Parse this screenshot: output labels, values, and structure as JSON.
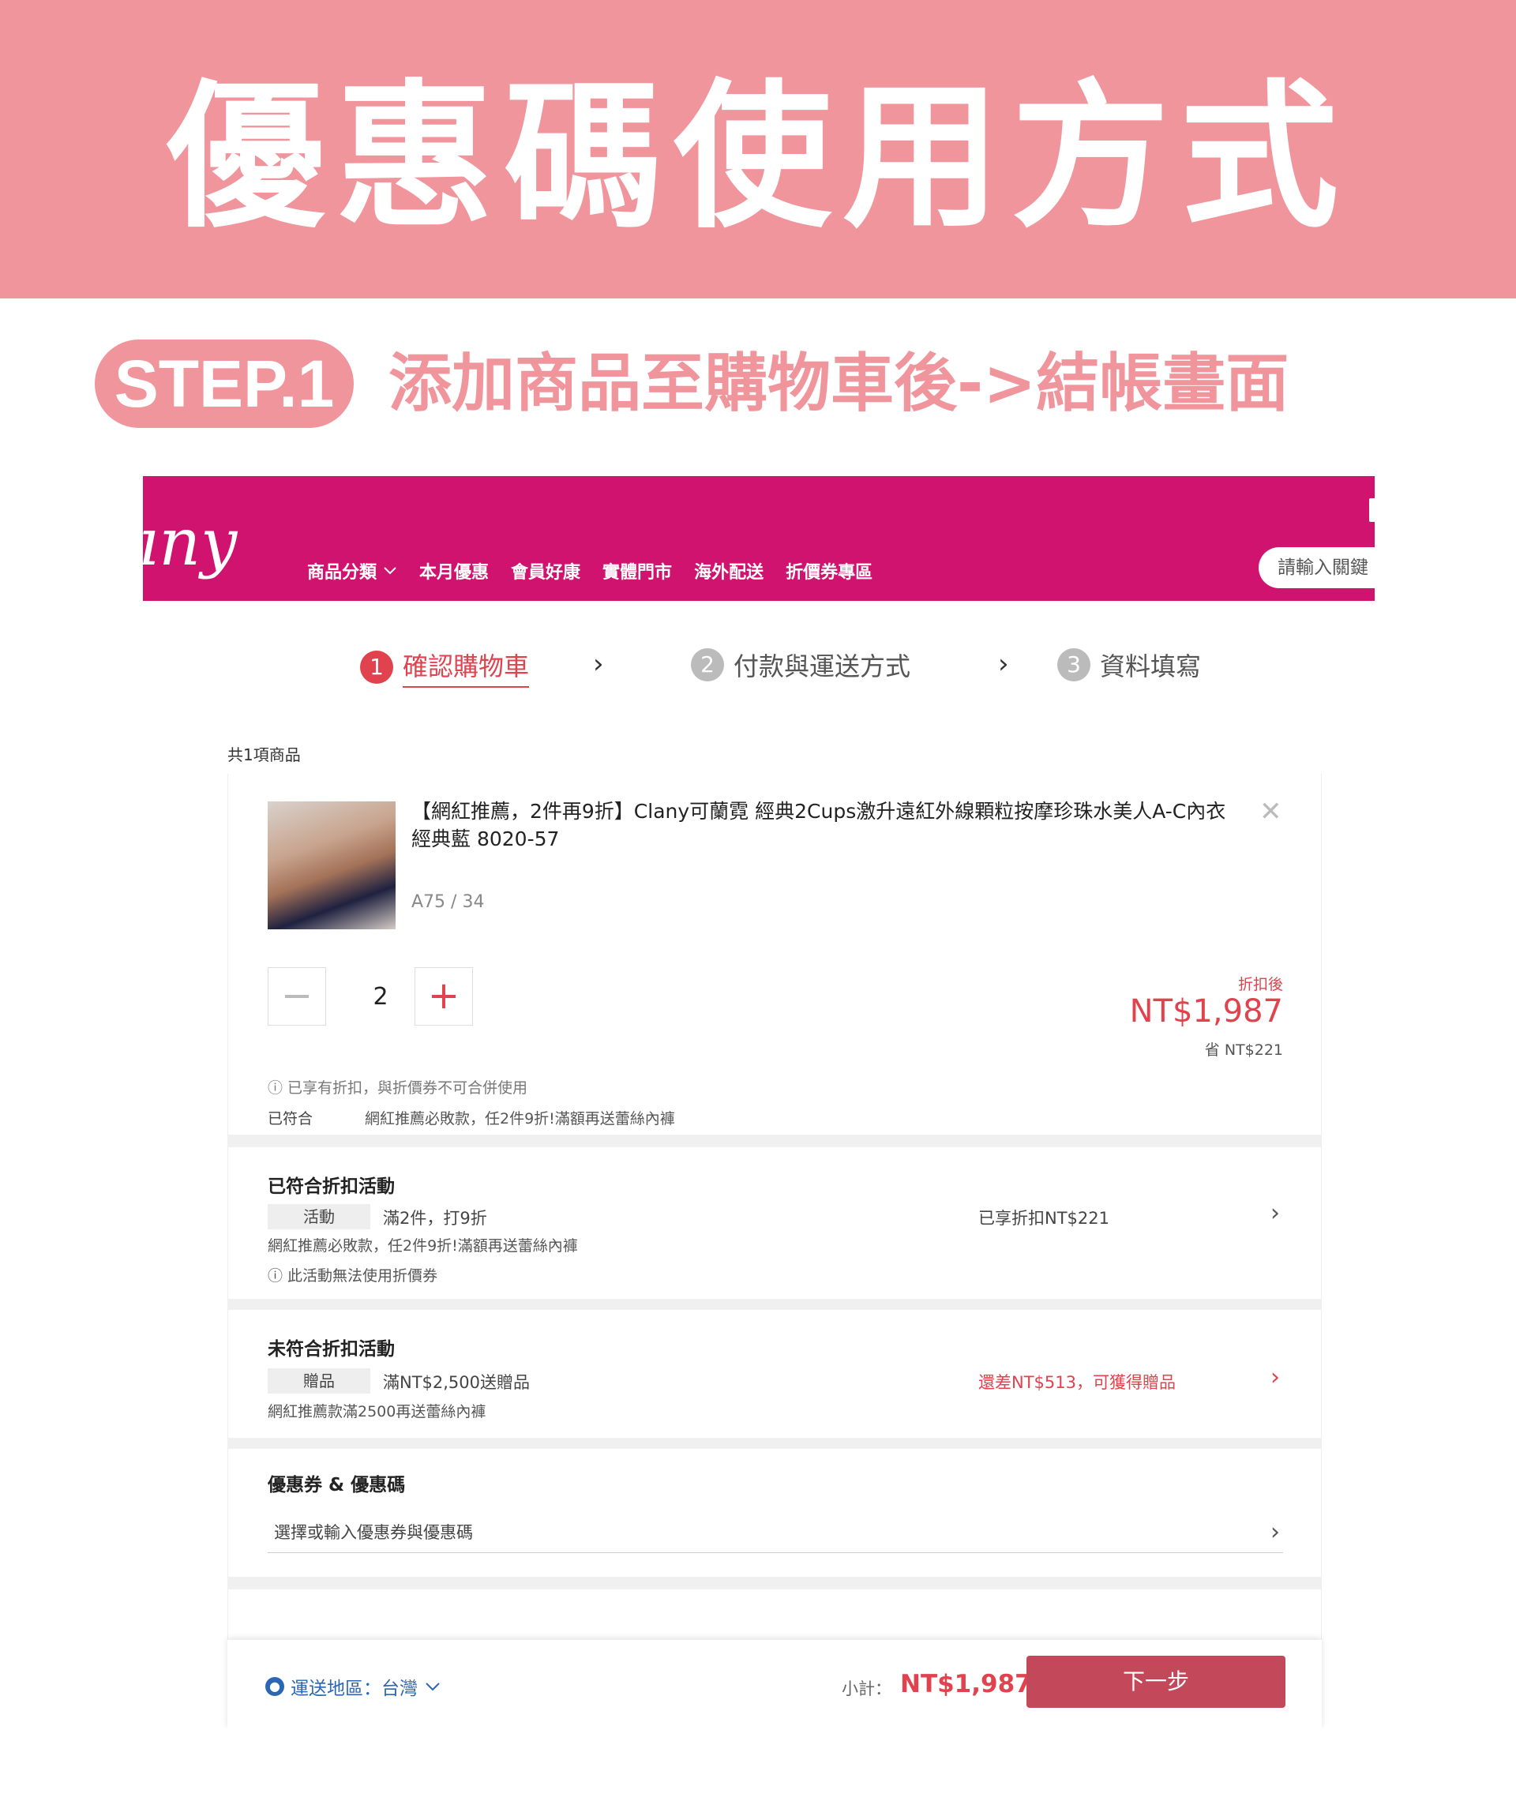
{
  "banner": {
    "title": "優惠碼使用方式"
  },
  "step": {
    "badge": "STEP.1",
    "text": "添加商品至購物車後->結帳畫面"
  },
  "navbar": {
    "logo": "ıny",
    "items": [
      "商品分類",
      "本月優惠",
      "會員好康",
      "實體門市",
      "海外配送",
      "折價券專區"
    ],
    "search_placeholder": "請輸入關鍵"
  },
  "checkout_steps": [
    {
      "num": "1",
      "label": "確認購物車"
    },
    {
      "num": "2",
      "label": "付款與運送方式"
    },
    {
      "num": "3",
      "label": "資料填寫"
    }
  ],
  "cart": {
    "count_text": "共1項商品",
    "product": {
      "name": "【網紅推薦，2件再9折】Clany可蘭霓 經典2Cups激升遠紅外線顆粒按摩珍珠水美人A-C內衣 經典藍 8020-57",
      "variant": "A75 / 34",
      "quantity": "2",
      "discount_label": "折扣後",
      "price": "NT$1,987",
      "saved": "省 NT$221",
      "note": "ⓘ 已享有折扣，與折價券不可合併使用",
      "matched_label": "已符合",
      "matched_desc": "網紅推薦必敗款，任2件9折!滿額再送蕾絲內褲"
    }
  },
  "matched_promo": {
    "title": "已符合折扣活動",
    "tag": "活動",
    "tag_text": "滿2件，打9折",
    "desc": "網紅推薦必敗款，任2件9折!滿額再送蕾絲內褲",
    "note": "ⓘ 此活動無法使用折價券",
    "status": "已享折扣NT$221"
  },
  "unmatched_promo": {
    "title": "未符合折扣活動",
    "tag": "贈品",
    "tag_text": "滿NT$2,500送贈品",
    "desc": "網紅推薦款滿2500再送蕾絲內褲",
    "status": "還差NT$513，可獲得贈品"
  },
  "coupon": {
    "title": "優惠券 & 優惠碼",
    "placeholder": "選擇或輸入優惠券與優惠碼"
  },
  "footer": {
    "shipping": "運送地區：台灣",
    "subtotal_label": "小計：",
    "subtotal": "NT$1,987",
    "next_button": "下一步"
  },
  "colors": {
    "banner": "#f0959c",
    "nav": "#d0136f",
    "accent": "#e0424e",
    "button": "#c2485a"
  }
}
